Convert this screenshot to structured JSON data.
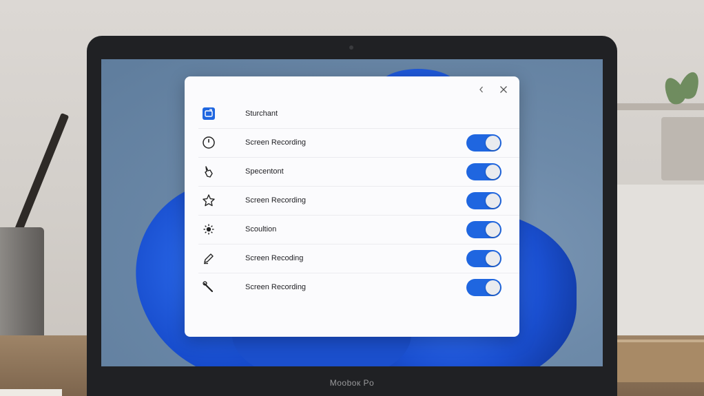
{
  "laptop": {
    "brand": "Mooboк Po"
  },
  "dialog": {
    "controls": {
      "back_icon": "chevron-left-icon",
      "close_icon": "close-icon"
    },
    "rows": [
      {
        "label": "Sturchant",
        "icon": "app-window-icon",
        "has_toggle": false
      },
      {
        "label": "Screen Recording",
        "icon": "clock-icon",
        "has_toggle": true,
        "toggle_on": true
      },
      {
        "label": "Specentont",
        "icon": "pointer-hand-icon",
        "has_toggle": true,
        "toggle_on": true
      },
      {
        "label": "Screen Recording",
        "icon": "star-icon",
        "has_toggle": true,
        "toggle_on": true
      },
      {
        "label": "Scoultion",
        "icon": "sun-icon",
        "has_toggle": true,
        "toggle_on": true
      },
      {
        "label": "Screen Recoding",
        "icon": "pen-icon",
        "has_toggle": true,
        "toggle_on": true
      },
      {
        "label": "Screen Recording",
        "icon": "wrench-icon",
        "has_toggle": true,
        "toggle_on": true
      }
    ],
    "accent_color": "#1f66e0"
  }
}
